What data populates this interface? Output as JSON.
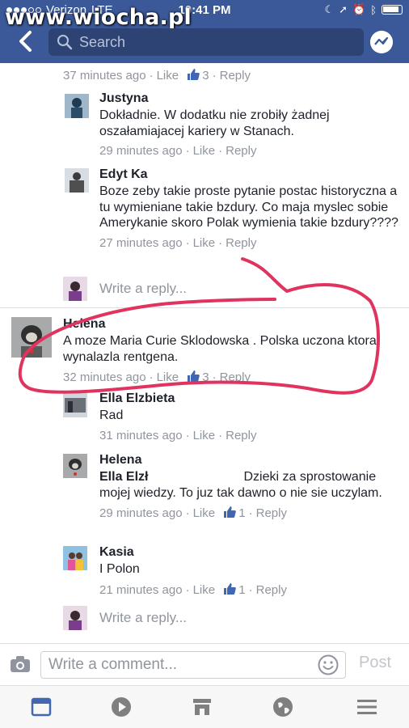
{
  "watermark": "www.wiocha.pl",
  "status_bar": {
    "carrier": "Verizon",
    "network": "LTE",
    "time": "10:41 PM"
  },
  "search": {
    "placeholder": "Search"
  },
  "top_meta": {
    "time": "37 minutes ago",
    "like": "Like",
    "likes": "3",
    "reply": "Reply"
  },
  "comments": [
    {
      "name": "Justyna",
      "text": "Dokładnie. W dodatku nie zrobiły żadnej oszałamiajacej kariery w Stanach.",
      "time": "29 minutes ago",
      "like": "Like",
      "reply": "Reply"
    },
    {
      "name": "Edyt Ka",
      "text": "Boze zeby takie proste pytanie postac historyczna a tu wymieniane takie bzdury. Co maja myslec sobie Amerykanie skoro Polak wymienia takie bzdury????",
      "time": "27 minutes ago",
      "like": "Like",
      "reply": "Reply"
    }
  ],
  "write_reply_1": "Write a reply...",
  "main_comment": {
    "name": "Helena",
    "text": "A moze Maria Curie Sklodowska .  Polska uczona ktora wynalazla rentgena.",
    "time": "32 minutes ago",
    "like": "Like",
    "likes": "3",
    "reply": "Reply"
  },
  "replies": [
    {
      "name": "Ella Elzbieta",
      "text": "Rad",
      "time": "31 minutes ago",
      "like": "Like",
      "reply": "Reply"
    },
    {
      "name": "Helena",
      "mention": "Ella Elzł",
      "text": "Dzieki za sprostowanie mojej wiedzy.  To juz tak dawno o nie sie uczylam.",
      "time": "29 minutes ago",
      "like": "Like",
      "likes": "1",
      "reply": "Reply"
    },
    {
      "name": "Kasia",
      "text": "I Polon",
      "time": "21 minutes ago",
      "like": "Like",
      "likes": "1",
      "reply": "Reply"
    }
  ],
  "write_reply_2": "Write a reply...",
  "composer": {
    "placeholder": "Write a comment...",
    "post": "Post"
  },
  "tabs": [
    "news-feed-icon",
    "video-icon",
    "marketplace-icon",
    "globe-icon",
    "menu-icon"
  ],
  "colors": {
    "header": "#3b5998",
    "annotation": "#e0335f",
    "meta": "#90949c",
    "tab_active": "#4267b2"
  }
}
